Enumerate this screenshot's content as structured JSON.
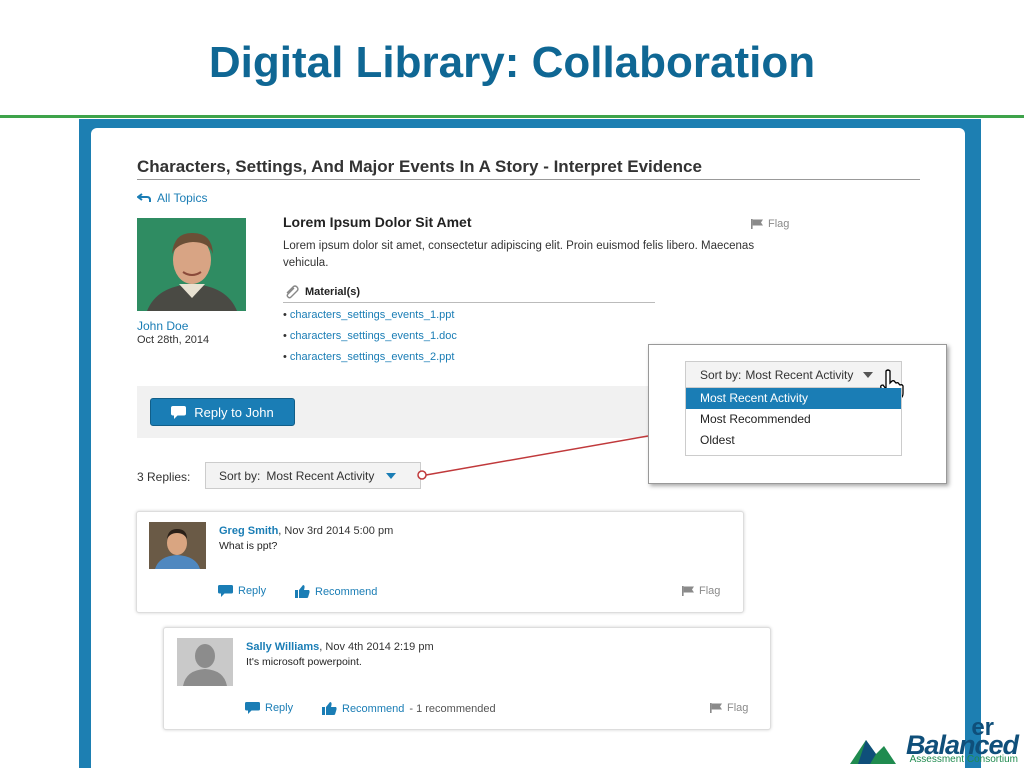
{
  "slide": {
    "title": "Digital Library: Collaboration"
  },
  "topic": {
    "title": "Characters, Settings, And Major Events In A Story - Interpret Evidence",
    "back_label": "All Topics"
  },
  "post": {
    "author": "John Doe",
    "date": "Oct 28th, 2014",
    "title": "Lorem Ipsum Dolor Sit Amet",
    "body": "Lorem ipsum dolor sit amet, consectetur adipiscing elit. Proin euismod felis libero. Maecenas vehicula.",
    "flag_label": "Flag",
    "materials_label": "Material(s)",
    "materials": [
      "characters_settings_events_1.ppt",
      "characters_settings_events_1.doc",
      "characters_settings_events_2.ppt"
    ],
    "reply_button": "Reply to John"
  },
  "replies": {
    "count_label": "3 Replies:",
    "sort_prefix": "Sort by:",
    "sort_value": "Most Recent Activity"
  },
  "sort_menu": {
    "prefix": "Sort by:",
    "value": "Most Recent Activity",
    "options": [
      "Most Recent Activity",
      "Most Recommended",
      "Oldest"
    ],
    "selected": "Most Recent Activity"
  },
  "comments": [
    {
      "name": "Greg Smith",
      "date": ", Nov 3rd 2014 5:00 pm",
      "text": "What is ppt?",
      "reply": "Reply",
      "recommend": "Recommend",
      "recommend_note": "",
      "flag": "Flag"
    },
    {
      "name": "Sally Williams",
      "date": ", Nov 4th 2014 2:19 pm",
      "text": "It's microsoft powerpoint.",
      "reply": "Reply",
      "recommend": "Recommend",
      "recommend_note": " - 1 recommended",
      "flag": "Flag"
    }
  ],
  "logo": {
    "top_text": "er",
    "brand": "Balanced",
    "tagline": "Assessment Consortium"
  },
  "colors": {
    "title": "#0f6794",
    "frame": "#1d7fb2",
    "link": "#1a7db5",
    "accent_rule": "#3ea34a",
    "callout_line": "#c0393b"
  }
}
